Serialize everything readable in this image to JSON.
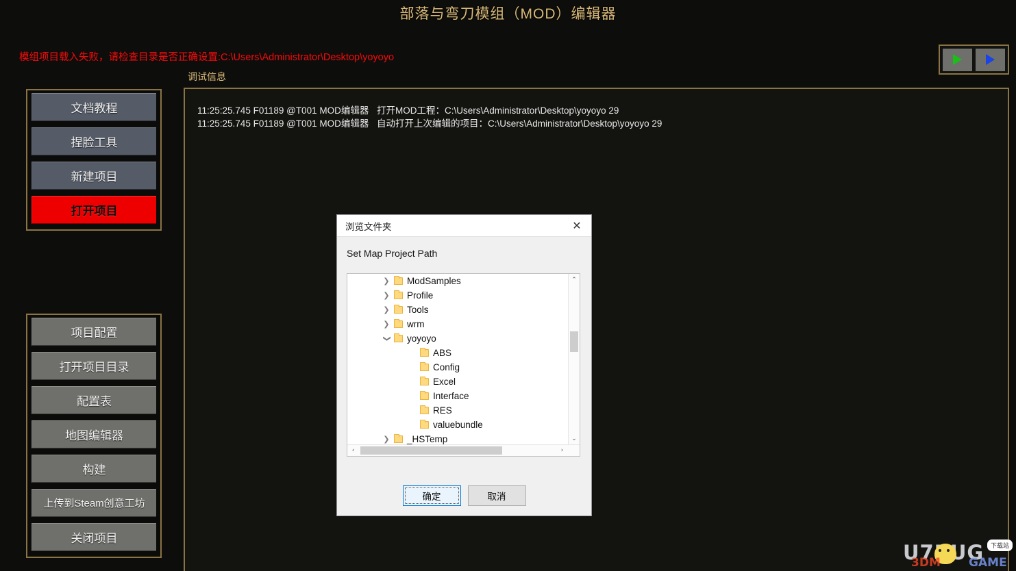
{
  "app": {
    "title": "部落与弯刀模组（MOD）编辑器",
    "accent_gold": "#d9b978",
    "error_color": "#e01010",
    "error_message": "模组项目载入失败，请检查目录是否正确设置:C:\\Users\\Administrator\\Desktop\\yoyoyo",
    "debug_label": "调试信息"
  },
  "toolbar": {
    "run_button_label": "▶",
    "debug_run_button_label": "▶"
  },
  "sidebar_top": {
    "items": [
      {
        "label": "文档教程",
        "active": false
      },
      {
        "label": "捏脸工具",
        "active": false
      },
      {
        "label": "新建项目",
        "active": false
      },
      {
        "label": "打开项目",
        "active": true
      }
    ]
  },
  "sidebar_bottom": {
    "items": [
      {
        "label": "项目配置",
        "small": false
      },
      {
        "label": "打开项目目录",
        "small": false
      },
      {
        "label": "配置表",
        "small": false
      },
      {
        "label": "地图编辑器",
        "small": false
      },
      {
        "label": "构建",
        "small": false
      },
      {
        "label": "上传到Steam创意工坊",
        "small": true
      },
      {
        "label": "关闭项目",
        "small": false
      }
    ]
  },
  "debug_panel": {
    "logs": [
      {
        "meta": "11:25:25.745 F01189 @T001 MOD编辑器",
        "message": "打开MOD工程：C:\\Users\\Administrator\\Desktop\\yoyoyo 29"
      },
      {
        "meta": "11:25:25.745 F01189 @T001 MOD编辑器",
        "message": "自动打开上次编辑的项目：C:\\Users\\Administrator\\Desktop\\yoyoyo 29"
      }
    ]
  },
  "dialog": {
    "title": "浏览文件夹",
    "close_label": "✕",
    "caption": "Set Map Project Path",
    "tree": [
      {
        "name": "ModSamples",
        "indent": 1,
        "twisty": "collapsed"
      },
      {
        "name": "Profile",
        "indent": 1,
        "twisty": "collapsed"
      },
      {
        "name": "Tools",
        "indent": 1,
        "twisty": "collapsed"
      },
      {
        "name": "wrm",
        "indent": 1,
        "twisty": "collapsed"
      },
      {
        "name": "yoyoyo",
        "indent": 1,
        "twisty": "expanded"
      },
      {
        "name": "ABS",
        "indent": 2,
        "twisty": "none"
      },
      {
        "name": "Config",
        "indent": 2,
        "twisty": "none"
      },
      {
        "name": "Excel",
        "indent": 2,
        "twisty": "none"
      },
      {
        "name": "Interface",
        "indent": 2,
        "twisty": "none"
      },
      {
        "name": "RES",
        "indent": 2,
        "twisty": "none"
      },
      {
        "name": "valuebundle",
        "indent": 2,
        "twisty": "none"
      },
      {
        "name": "_HSTemp",
        "indent": 1,
        "twisty": "collapsed"
      }
    ],
    "scrollbar": {
      "up_arrow": "⌃",
      "down_arrow": "⌄",
      "left_arrow": "‹",
      "right_arrow": "›"
    },
    "ok_label": "确定",
    "cancel_label": "取消"
  },
  "watermark": {
    "main": "U7BUG",
    "badge": "下载站",
    "sub": "3DM",
    "sub2": "GAME"
  }
}
